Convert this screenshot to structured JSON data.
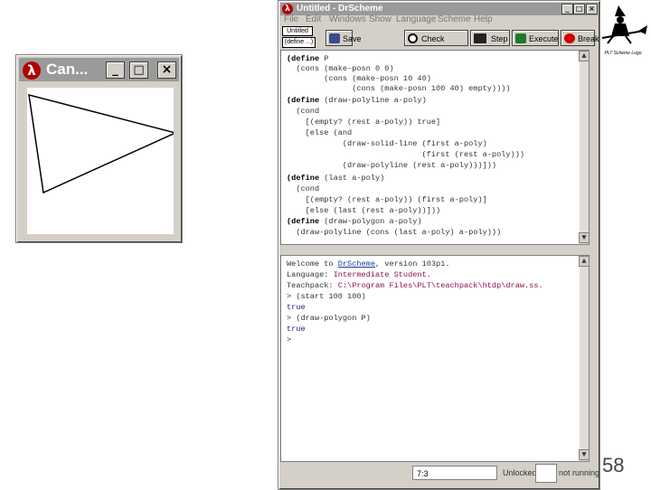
{
  "canvas_window": {
    "title": "Can...",
    "min": "_",
    "max": "□",
    "close": "×"
  },
  "main_window": {
    "title": "Untitled - DrScheme",
    "min": "_",
    "max": "□",
    "close": "×",
    "menu": [
      "File",
      "Edit",
      "Windows",
      "Show",
      "Language",
      "Scheme",
      "Help"
    ],
    "file_button": "Untitled",
    "define_button": "(define ...)",
    "toolbar": {
      "save": "Save",
      "check": "Check Syntax",
      "step": "Step",
      "execute": "Execute",
      "break": "Break"
    }
  },
  "code_lines": [
    {
      "k": "(define",
      "r": " P"
    },
    {
      "k": "",
      "r": "  (cons (make-posn 0 0)"
    },
    {
      "k": "",
      "r": "        (cons (make-posn 10 40)"
    },
    {
      "k": "",
      "r": "              (cons (make-posn 100 40) empty))))"
    },
    {
      "k": "(define",
      "r": " (draw-polyline a-poly)"
    },
    {
      "k": "",
      "r": "  (cond"
    },
    {
      "k": "",
      "r": "    [(empty? (rest a-poly)) true]"
    },
    {
      "k": "",
      "r": "    [else (and"
    },
    {
      "k": "",
      "r": "            (draw-solid-line (first a-poly)"
    },
    {
      "k": "",
      "r": "                             (first (rest a-poly)))"
    },
    {
      "k": "",
      "r": "            (draw-polyline (rest a-poly)))]))"
    },
    {
      "k": "(define",
      "r": " (last a-poly)"
    },
    {
      "k": "",
      "r": "  (cond"
    },
    {
      "k": "",
      "r": "    [(empty? (rest a-poly)) (first a-poly)]"
    },
    {
      "k": "",
      "r": "    [else (last (rest a-poly))]))"
    },
    {
      "k": "(define",
      "r": " (draw-polygon a-poly)"
    },
    {
      "k": "",
      "r": "  (draw-polyline (cons (last a-poly) a-poly)))"
    }
  ],
  "repl": {
    "welcome": "Welcome to ",
    "drscheme_link": "DrScheme",
    "version": ", version 103p1.",
    "language_label": "Language: ",
    "language": "Intermediate Student.",
    "teachpack_label": "Teachpack: ",
    "teachpack": "C:\\Program Files\\PLT\\teachpack\\htdp\\draw.ss.",
    "cmd1": "> (start 100 100)",
    "result1": "true",
    "cmd2": "> (draw-polygon P)",
    "result2": "true",
    "prompt": ">"
  },
  "status": {
    "position": "7:3",
    "unlocked": "Unlocked",
    "running": "not running"
  },
  "page_number": "58",
  "logo_caption": "PLT Scheme Logo"
}
